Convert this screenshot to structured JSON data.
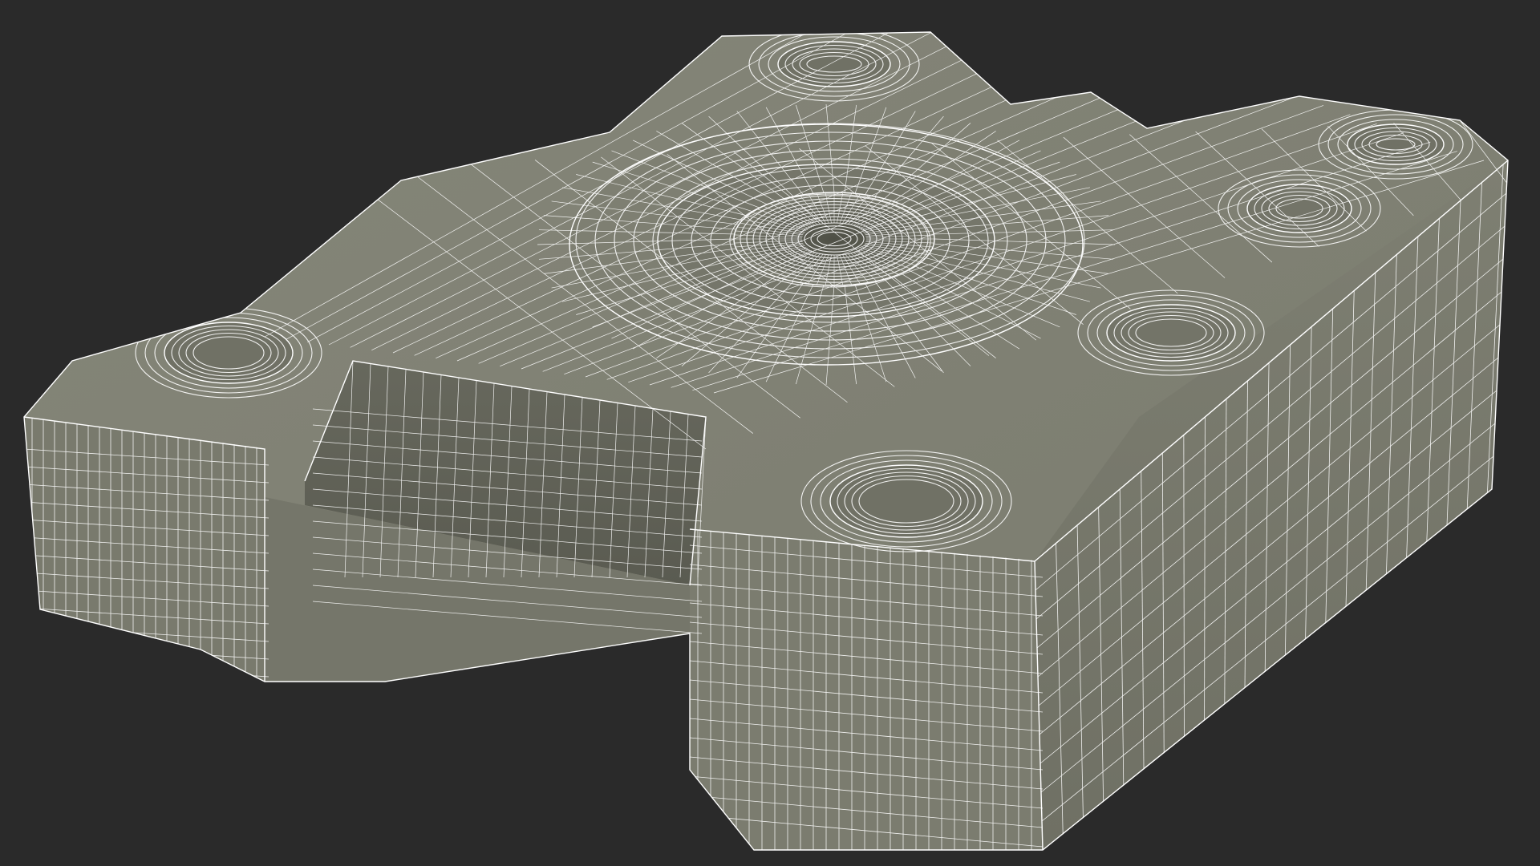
{
  "scene": {
    "background_color": "#2a2a2a",
    "surface_color": "#7d7e71",
    "surface_dark_color": "#5f6055",
    "surface_light_color": "#8e8f82",
    "wire_color": "#ffffff",
    "object": "wireframe-3d-model"
  }
}
